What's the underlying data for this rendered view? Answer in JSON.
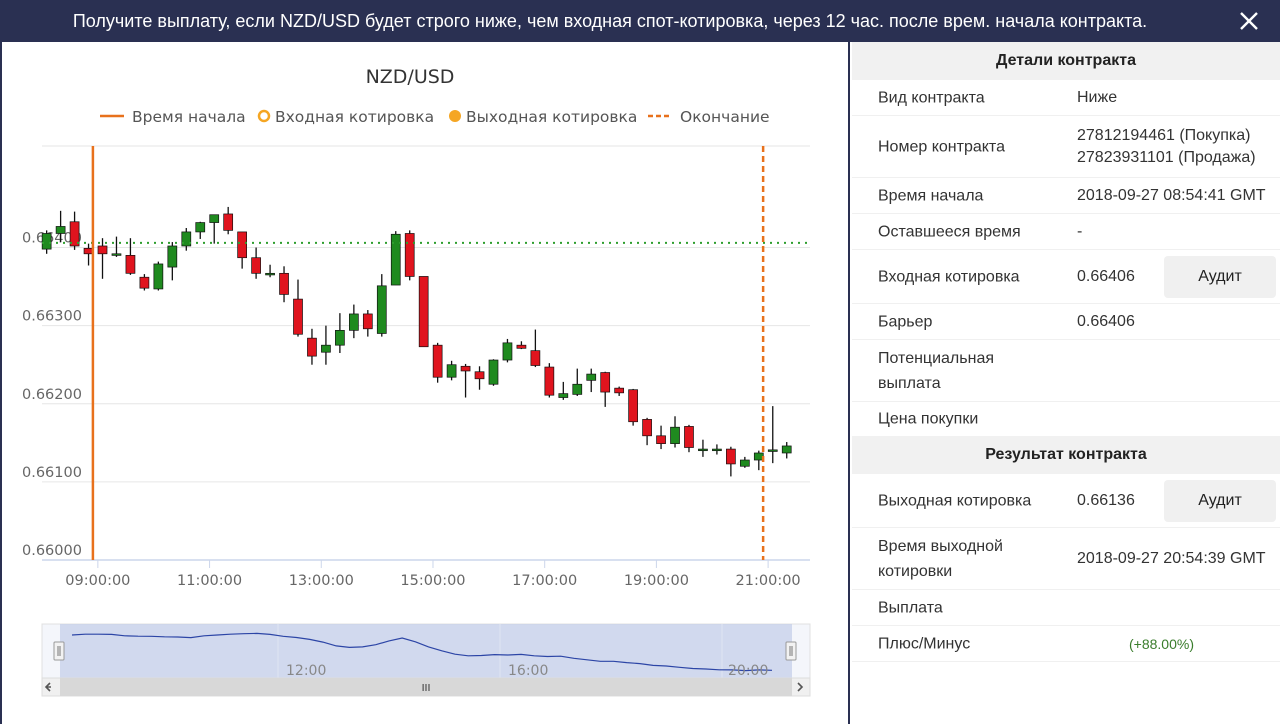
{
  "header": {
    "title": "Получите выплату, если NZD/USD будет строго ниже, чем входная спот-котировка, через 12 час. после врем. начала контракта."
  },
  "colors": {
    "header_bg": "#2a3052",
    "bull": "#1f8a1f",
    "bear": "#e0141e",
    "start_line": "#e8711c",
    "end_line": "#e8711c",
    "barrier": "#2e9e2e",
    "navigator_fill": "#c5cfe9",
    "navigator_line": "#2c45a6"
  },
  "chart": {
    "title": "NZD/USD",
    "legend": [
      {
        "label": "Время начала",
        "icon": "solid-line-icon"
      },
      {
        "label": "Входная котировка",
        "icon": "hollow-dot-icon"
      },
      {
        "label": "Выходная котировка",
        "icon": "filled-dot-icon"
      },
      {
        "label": "Окончание",
        "icon": "dashed-line-icon"
      }
    ],
    "y_ticks": [
      "0.66000",
      "0.66100",
      "0.66200",
      "0.66300",
      "0.66400"
    ],
    "x_ticks": [
      "09:00:00",
      "11:00:00",
      "13:00:00",
      "15:00:00",
      "17:00:00",
      "19:00:00",
      "21:00:00"
    ],
    "navigator_ticks": [
      "12:00",
      "16:00",
      "20:00"
    ],
    "scrollbar_grip": "III"
  },
  "chart_data": {
    "type": "candlestick",
    "title": "NZD/USD",
    "ylim": [
      0.66,
      0.6653
    ],
    "x_range": [
      "08:00",
      "21:45"
    ],
    "start_time": "08:54:41",
    "end_time": "20:54:39",
    "barrier": 0.66406,
    "candles": [
      {
        "t": "08:05",
        "o": 0.66398,
        "h": 0.66422,
        "l": 0.66392,
        "c": 0.66418
      },
      {
        "t": "08:20",
        "o": 0.66418,
        "h": 0.66447,
        "l": 0.66407,
        "c": 0.66427
      },
      {
        "t": "08:35",
        "o": 0.66433,
        "h": 0.66446,
        "l": 0.66397,
        "c": 0.66402
      },
      {
        "t": "08:50",
        "o": 0.66399,
        "h": 0.66405,
        "l": 0.66377,
        "c": 0.66392
      },
      {
        "t": "09:05",
        "o": 0.66402,
        "h": 0.66412,
        "l": 0.6636,
        "c": 0.66392
      },
      {
        "t": "09:20",
        "o": 0.66392,
        "h": 0.66414,
        "l": 0.66388,
        "c": 0.66392
      },
      {
        "t": "09:35",
        "o": 0.6639,
        "h": 0.66412,
        "l": 0.66365,
        "c": 0.66367
      },
      {
        "t": "09:50",
        "o": 0.66362,
        "h": 0.66366,
        "l": 0.66345,
        "c": 0.66348
      },
      {
        "t": "10:05",
        "o": 0.66347,
        "h": 0.66382,
        "l": 0.66345,
        "c": 0.66379
      },
      {
        "t": "10:20",
        "o": 0.66375,
        "h": 0.66407,
        "l": 0.66358,
        "c": 0.66402
      },
      {
        "t": "10:35",
        "o": 0.66402,
        "h": 0.66425,
        "l": 0.66396,
        "c": 0.6642
      },
      {
        "t": "10:50",
        "o": 0.6642,
        "h": 0.66433,
        "l": 0.66411,
        "c": 0.66432
      },
      {
        "t": "11:05",
        "o": 0.66432,
        "h": 0.66442,
        "l": 0.66405,
        "c": 0.66442
      },
      {
        "t": "11:20",
        "o": 0.66443,
        "h": 0.66452,
        "l": 0.66417,
        "c": 0.66422
      },
      {
        "t": "11:35",
        "o": 0.6642,
        "h": 0.6642,
        "l": 0.66373,
        "c": 0.66387
      },
      {
        "t": "11:50",
        "o": 0.66387,
        "h": 0.664,
        "l": 0.6636,
        "c": 0.66367
      },
      {
        "t": "12:05",
        "o": 0.66367,
        "h": 0.66378,
        "l": 0.66362,
        "c": 0.66367
      },
      {
        "t": "12:20",
        "o": 0.66367,
        "h": 0.66376,
        "l": 0.6633,
        "c": 0.6634
      },
      {
        "t": "12:35",
        "o": 0.66334,
        "h": 0.66359,
        "l": 0.66286,
        "c": 0.66289
      },
      {
        "t": "12:50",
        "o": 0.66284,
        "h": 0.66296,
        "l": 0.6625,
        "c": 0.66261
      },
      {
        "t": "13:05",
        "o": 0.66266,
        "h": 0.663,
        "l": 0.6625,
        "c": 0.66275
      },
      {
        "t": "13:20",
        "o": 0.66275,
        "h": 0.66316,
        "l": 0.66265,
        "c": 0.66294
      },
      {
        "t": "13:35",
        "o": 0.66294,
        "h": 0.66327,
        "l": 0.66284,
        "c": 0.66315
      },
      {
        "t": "13:50",
        "o": 0.66315,
        "h": 0.6632,
        "l": 0.66286,
        "c": 0.66296
      },
      {
        "t": "14:05",
        "o": 0.6629,
        "h": 0.66366,
        "l": 0.66286,
        "c": 0.66351
      },
      {
        "t": "14:20",
        "o": 0.66352,
        "h": 0.66421,
        "l": 0.66352,
        "c": 0.66417
      },
      {
        "t": "14:35",
        "o": 0.66418,
        "h": 0.66422,
        "l": 0.66358,
        "c": 0.66363
      },
      {
        "t": "14:50",
        "o": 0.66363,
        "h": 0.66363,
        "l": 0.66273,
        "c": 0.66273
      },
      {
        "t": "15:05",
        "o": 0.66275,
        "h": 0.66278,
        "l": 0.66227,
        "c": 0.66234
      },
      {
        "t": "15:20",
        "o": 0.66234,
        "h": 0.66255,
        "l": 0.6623,
        "c": 0.6625
      },
      {
        "t": "15:35",
        "o": 0.66248,
        "h": 0.66251,
        "l": 0.66208,
        "c": 0.66242
      },
      {
        "t": "15:50",
        "o": 0.66241,
        "h": 0.66248,
        "l": 0.66218,
        "c": 0.66232
      },
      {
        "t": "16:05",
        "o": 0.66225,
        "h": 0.66257,
        "l": 0.66223,
        "c": 0.66256
      },
      {
        "t": "16:20",
        "o": 0.66256,
        "h": 0.66283,
        "l": 0.66253,
        "c": 0.66278
      },
      {
        "t": "16:35",
        "o": 0.66275,
        "h": 0.6628,
        "l": 0.6627,
        "c": 0.66271
      },
      {
        "t": "16:50",
        "o": 0.66268,
        "h": 0.66295,
        "l": 0.66247,
        "c": 0.66249
      },
      {
        "t": "17:05",
        "o": 0.66247,
        "h": 0.66252,
        "l": 0.66208,
        "c": 0.66211
      },
      {
        "t": "17:20",
        "o": 0.66208,
        "h": 0.66228,
        "l": 0.66205,
        "c": 0.66213
      },
      {
        "t": "17:35",
        "o": 0.66212,
        "h": 0.66245,
        "l": 0.6621,
        "c": 0.66225
      },
      {
        "t": "17:50",
        "o": 0.6623,
        "h": 0.66245,
        "l": 0.66215,
        "c": 0.66238
      },
      {
        "t": "18:05",
        "o": 0.6624,
        "h": 0.66241,
        "l": 0.66196,
        "c": 0.66215
      },
      {
        "t": "18:20",
        "o": 0.6622,
        "h": 0.66222,
        "l": 0.6621,
        "c": 0.66214
      },
      {
        "t": "18:35",
        "o": 0.66218,
        "h": 0.66219,
        "l": 0.66172,
        "c": 0.66177
      },
      {
        "t": "18:50",
        "o": 0.6618,
        "h": 0.66182,
        "l": 0.66147,
        "c": 0.66159
      },
      {
        "t": "19:05",
        "o": 0.66159,
        "h": 0.66172,
        "l": 0.66142,
        "c": 0.66149
      },
      {
        "t": "19:20",
        "o": 0.66149,
        "h": 0.66184,
        "l": 0.66144,
        "c": 0.6617
      },
      {
        "t": "19:35",
        "o": 0.66171,
        "h": 0.66173,
        "l": 0.66138,
        "c": 0.66144
      },
      {
        "t": "19:50",
        "o": 0.66142,
        "h": 0.66154,
        "l": 0.66132,
        "c": 0.66142
      },
      {
        "t": "20:05",
        "o": 0.66142,
        "h": 0.66148,
        "l": 0.66135,
        "c": 0.66142
      },
      {
        "t": "20:20",
        "o": 0.66142,
        "h": 0.66145,
        "l": 0.66107,
        "c": 0.66123
      },
      {
        "t": "20:35",
        "o": 0.6612,
        "h": 0.66132,
        "l": 0.66118,
        "c": 0.66128
      },
      {
        "t": "20:50",
        "o": 0.66128,
        "h": 0.6614,
        "l": 0.66115,
        "c": 0.66137
      },
      {
        "t": "21:05",
        "o": 0.6614,
        "h": 0.66197,
        "l": 0.66124,
        "c": 0.66141
      },
      {
        "t": "21:20",
        "o": 0.66137,
        "h": 0.66151,
        "l": 0.6613,
        "c": 0.66146
      }
    ],
    "navigator_series": [
      0.66425,
      0.66432,
      0.66432,
      0.6643,
      0.66418,
      0.66415,
      0.66414,
      0.6641,
      0.66408,
      0.66403,
      0.66418,
      0.66425,
      0.66432,
      0.66436,
      0.66438,
      0.6643,
      0.66414,
      0.66404,
      0.66388,
      0.66366,
      0.66334,
      0.66322,
      0.66326,
      0.66344,
      0.66376,
      0.664,
      0.66368,
      0.66326,
      0.66293,
      0.66265,
      0.66252,
      0.66254,
      0.66262,
      0.66258,
      0.66263,
      0.66252,
      0.66246,
      0.66248,
      0.66231,
      0.66218,
      0.66206,
      0.66206,
      0.66195,
      0.66187,
      0.66172,
      0.66167,
      0.66156,
      0.66146,
      0.66142,
      0.66135,
      0.66134,
      0.66128,
      0.66134,
      0.66131
    ],
    "navigator_range": [
      "08:00",
      "21:45"
    ]
  },
  "details": {
    "heading": "Детали контракта",
    "rows": [
      {
        "label": "Вид контракта",
        "value": "Ниже"
      },
      {
        "label": "Номер контракта",
        "value": "27812194461 (Покупка)",
        "value2": "27823931101 (Продажа)"
      },
      {
        "label": "Время начала",
        "value": "2018-09-27 08:54:41 GMT"
      },
      {
        "label": "Оставшееся время",
        "value": "-"
      },
      {
        "label": "Входная котировка",
        "value": "0.66406",
        "button": "Аудит"
      },
      {
        "label": "Барьер",
        "value": "0.66406"
      },
      {
        "label": "Потенциальная выплата",
        "value": ""
      },
      {
        "label": "Цена покупки",
        "value": ""
      }
    ]
  },
  "result": {
    "heading": "Результат контракта",
    "rows": [
      {
        "label": "Выходная котировка",
        "value": "0.66136",
        "button": "Аудит"
      },
      {
        "label": "Время выходной котировки",
        "value": "2018-09-27 20:54:39 GMT"
      },
      {
        "label": "Выплата",
        "value": ""
      },
      {
        "label": "Плюс/Минус",
        "value": "(+88.00%)"
      }
    ]
  }
}
